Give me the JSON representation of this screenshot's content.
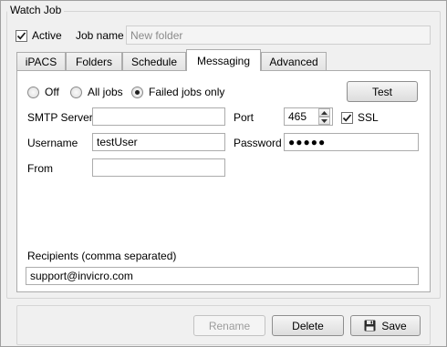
{
  "group_title": "Watch Job",
  "active": {
    "label": "Active",
    "checked": true
  },
  "job_name": {
    "label": "Job name",
    "placeholder": "New folder"
  },
  "tabs": [
    {
      "label": "iPACS",
      "active": false
    },
    {
      "label": "Folders",
      "active": false
    },
    {
      "label": "Schedule",
      "active": false
    },
    {
      "label": "Messaging",
      "active": true
    },
    {
      "label": "Advanced",
      "active": false
    }
  ],
  "messaging": {
    "radio_options": [
      {
        "label": "Off",
        "selected": false
      },
      {
        "label": "All jobs",
        "selected": false
      },
      {
        "label": "Failed jobs only",
        "selected": true
      }
    ],
    "test_button": "Test",
    "smtp_server": {
      "label": "SMTP Server",
      "value": ""
    },
    "port": {
      "label": "Port",
      "value": "465"
    },
    "ssl": {
      "label": "SSL",
      "checked": true
    },
    "username": {
      "label": "Username",
      "value": "testUser"
    },
    "password": {
      "label": "Password",
      "value": "●●●●●"
    },
    "from": {
      "label": "From",
      "value": ""
    },
    "recipients": {
      "label": "Recipients (comma separated)",
      "value": "support@invicro.com"
    }
  },
  "buttons": {
    "rename": "Rename",
    "delete": "Delete",
    "save": "Save"
  },
  "icons": {
    "check": "check-icon",
    "save": "floppy-disk-icon",
    "spin_up": "arrow-up-icon",
    "spin_down": "arrow-down-icon"
  }
}
